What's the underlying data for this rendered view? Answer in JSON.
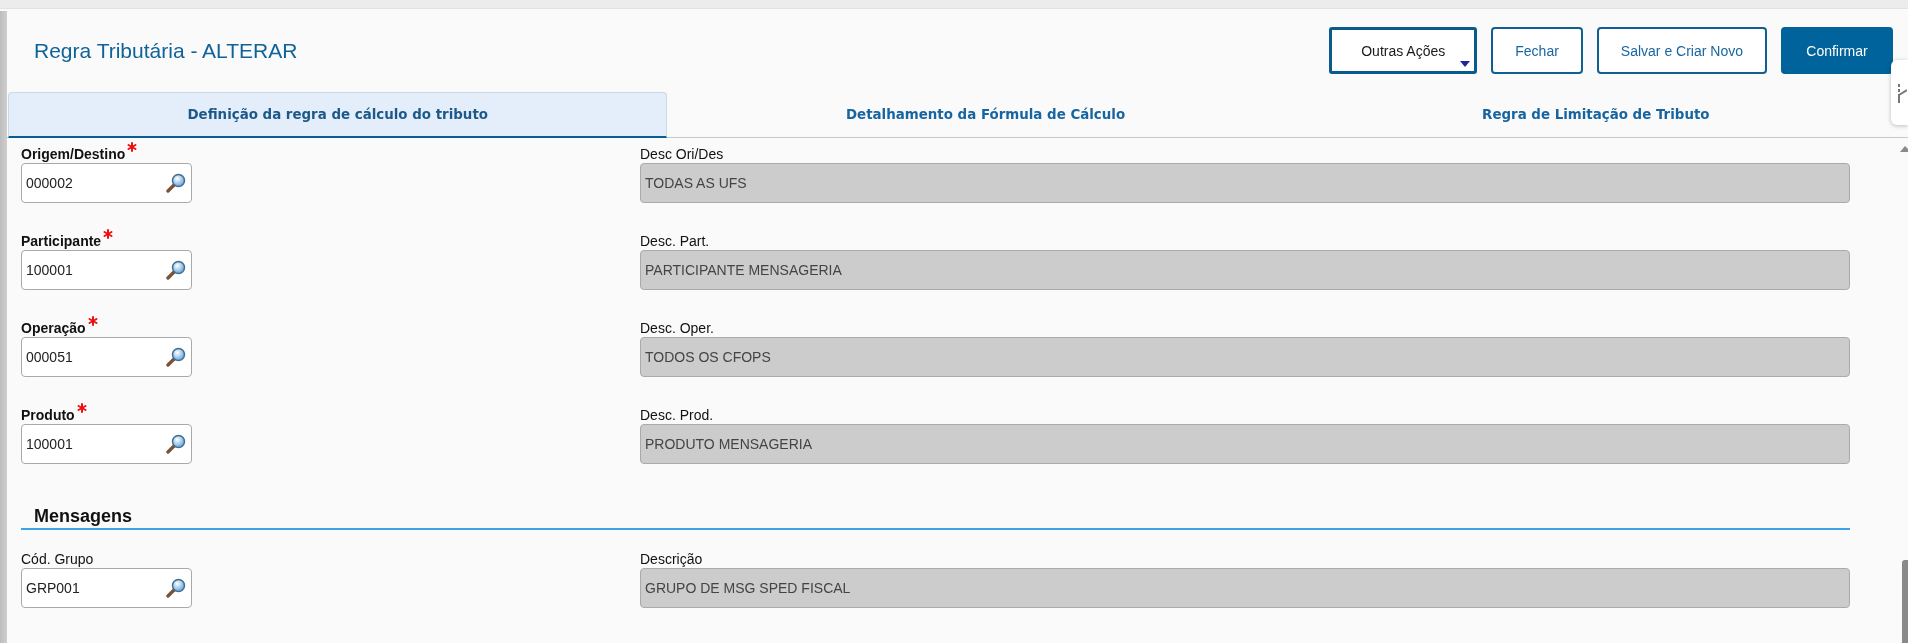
{
  "header": {
    "title": "Regra Tributária - ALTERAR"
  },
  "actions": [
    {
      "label": "Outras Ações",
      "kind": "dropdown",
      "focused": true
    },
    {
      "label": "Fechar",
      "kind": "outline",
      "focused": false
    },
    {
      "label": "Salvar e Criar Novo",
      "kind": "outline",
      "focused": false
    },
    {
      "label": "Confirmar",
      "kind": "primary",
      "focused": false
    }
  ],
  "tabs": [
    {
      "label": "Definição da regra de cálculo do tributo",
      "selected": true
    },
    {
      "label": "Detalhamento da Fórmula de Cálculo",
      "selected": false
    },
    {
      "label": "Regra de Limitação de Tributo",
      "selected": false
    }
  ],
  "fields": [
    {
      "label": "Origem/Destino",
      "required": true,
      "value": "000002",
      "description": {
        "label": "Desc Ori/Des",
        "value": "TODAS AS UFS",
        "disabled": true
      }
    },
    {
      "label": "Participante",
      "required": true,
      "value": "100001",
      "description": {
        "label": "Desc. Part.",
        "value": "PARTICIPANTE MENSAGERIA",
        "disabled": true
      }
    },
    {
      "label": "Operação",
      "required": true,
      "value": "000051",
      "description": {
        "label": "Desc. Oper.",
        "value": "TODOS OS CFOPS",
        "disabled": true
      }
    },
    {
      "label": "Produto",
      "required": true,
      "value": "100001",
      "description": {
        "label": "Desc. Prod.",
        "value": "PRODUTO MENSAGERIA",
        "disabled": true
      }
    }
  ],
  "sections": [
    {
      "title": "Mensagens",
      "fields": [
        {
          "label": "Cód. Grupo",
          "required": false,
          "value": "GRP001",
          "description": {
            "label": "Descrição",
            "value": "GRUPO DE MSG SPED FISCAL",
            "disabled": true
          }
        }
      ]
    }
  ]
}
